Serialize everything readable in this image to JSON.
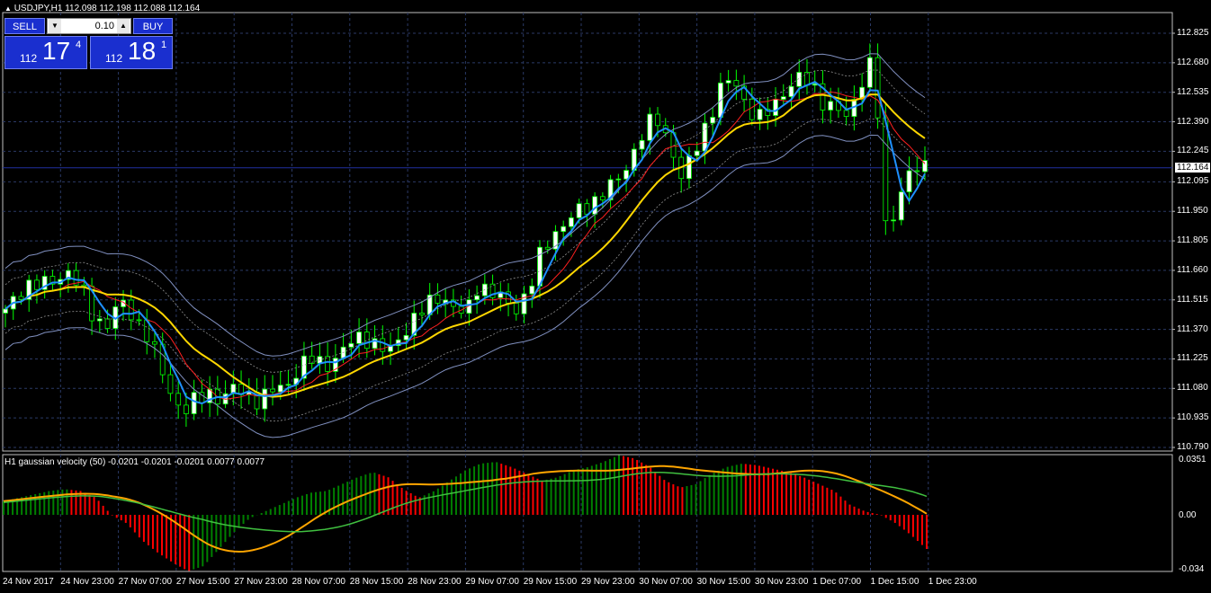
{
  "header": {
    "symbol_line": "USDJPY,H1  112.098 112.198 112.088 112.164"
  },
  "indicator": {
    "label": "H1 gaussian velocity (50) -0.0201 -0.0201 -0.0201 0.0077 0.0077",
    "axis_top": "0.0351",
    "axis_mid": "0.00",
    "axis_bottom": "-0.034"
  },
  "trade_panel": {
    "sell_label": "SELL",
    "buy_label": "BUY",
    "lot_value": "0.10",
    "sell_small": "112",
    "sell_big": "17",
    "sell_sup": "4",
    "buy_small": "112",
    "buy_big": "18",
    "buy_sup": "1"
  },
  "price_axis": [
    "112.825",
    "112.680",
    "112.535",
    "112.390",
    "112.245",
    "112.095",
    "111.950",
    "111.805",
    "111.660",
    "111.515",
    "111.370",
    "111.225",
    "111.080",
    "110.935",
    "110.790"
  ],
  "current_price": "112.164",
  "time_axis": [
    "24 Nov 2017",
    "24 Nov 23:00",
    "27 Nov 07:00",
    "27 Nov 15:00",
    "27 Nov 23:00",
    "28 Nov 07:00",
    "28 Nov 15:00",
    "28 Nov 23:00",
    "29 Nov 07:00",
    "29 Nov 15:00",
    "29 Nov 23:00",
    "30 Nov 07:00",
    "30 Nov 15:00",
    "30 Nov 23:00",
    "1 Dec 07:00",
    "1 Dec 15:00",
    "1 Dec 23:00"
  ],
  "colors": {
    "background": "#000000",
    "grid": "#2b3a66",
    "bull_candle": "#ffffff",
    "bear_candle": "#000000",
    "wick": "#00ff00",
    "ma_yellow": "#ffd700",
    "ma_blue": "#1e90ff",
    "ma_red": "#ff2020",
    "band": "#8090c0",
    "hist_green": "#008000",
    "hist_red": "#ff0000",
    "signal": "#ffa500",
    "slow_line": "#40c040"
  },
  "chart_data": {
    "type": "candlestick",
    "symbol": "USDJPY",
    "timeframe": "H1",
    "ylim": [
      110.79,
      112.825
    ],
    "close_path": [
      111.45,
      111.55,
      111.6,
      111.58,
      111.62,
      111.66,
      111.55,
      111.42,
      111.4,
      111.5,
      111.44,
      111.36,
      111.2,
      111.05,
      110.97,
      111.02,
      111.06,
      111.03,
      111.08,
      111.05,
      111.02,
      111.07,
      111.1,
      111.18,
      111.22,
      111.2,
      111.23,
      111.3,
      111.35,
      111.29,
      111.25,
      111.35,
      111.42,
      111.48,
      111.55,
      111.48,
      111.43,
      111.6,
      111.55,
      111.51,
      111.48,
      111.56,
      111.75,
      111.85,
      111.9,
      111.95,
      112.0,
      112.05,
      112.1,
      112.22,
      112.35,
      112.4,
      112.3,
      112.1,
      112.25,
      112.4,
      112.55,
      112.6,
      112.48,
      112.4,
      112.45,
      112.55,
      112.6,
      112.58,
      112.5,
      112.45,
      112.4,
      112.6,
      112.7,
      111.8,
      112.05,
      112.15,
      112.16
    ],
    "velocity_hist": [
      0.008,
      0.01,
      0.012,
      0.014,
      0.015,
      0.014,
      0.01,
      0.0,
      -0.005,
      -0.015,
      -0.022,
      -0.028,
      -0.033,
      -0.03,
      -0.02,
      -0.01,
      -0.002,
      0.002,
      0.006,
      0.01,
      0.013,
      0.014,
      0.018,
      0.022,
      0.025,
      0.022,
      0.015,
      0.01,
      0.014,
      0.02,
      0.026,
      0.03,
      0.031,
      0.028,
      0.024,
      0.02,
      0.022,
      0.026,
      0.028,
      0.031,
      0.035,
      0.033,
      0.028,
      0.02,
      0.016,
      0.018,
      0.024,
      0.028,
      0.03,
      0.029,
      0.027,
      0.025,
      0.022,
      0.018,
      0.014,
      0.006,
      0.002,
      0.0,
      -0.005,
      -0.012,
      -0.02
    ]
  }
}
